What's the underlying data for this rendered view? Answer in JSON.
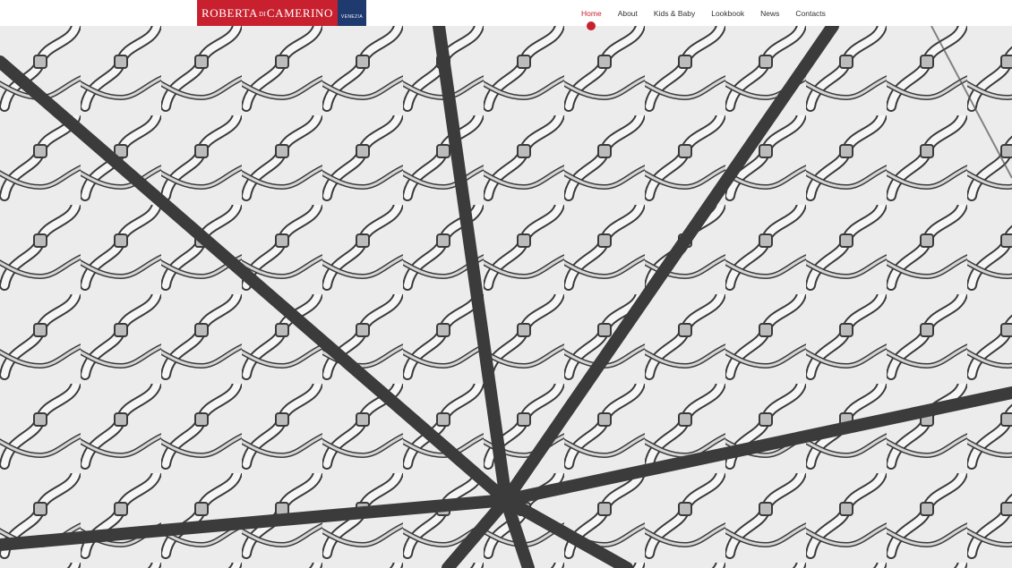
{
  "brand": {
    "logo_main_a": "ROBERTA",
    "logo_main_di": "DI",
    "logo_main_b": "CAMERINO",
    "logo_side": "VENEZIA",
    "primary_color": "#c8202f",
    "secondary_color": "#1e3a6e"
  },
  "nav": {
    "items": [
      {
        "label": "Home",
        "active": true
      },
      {
        "label": "About",
        "active": false
      },
      {
        "label": "Kids & Baby",
        "active": false
      },
      {
        "label": "Lookbook",
        "active": false
      },
      {
        "label": "News",
        "active": false
      },
      {
        "label": "Contacts",
        "active": false
      }
    ]
  },
  "hero": {
    "image_name": "knitted-mesh-illustration"
  }
}
